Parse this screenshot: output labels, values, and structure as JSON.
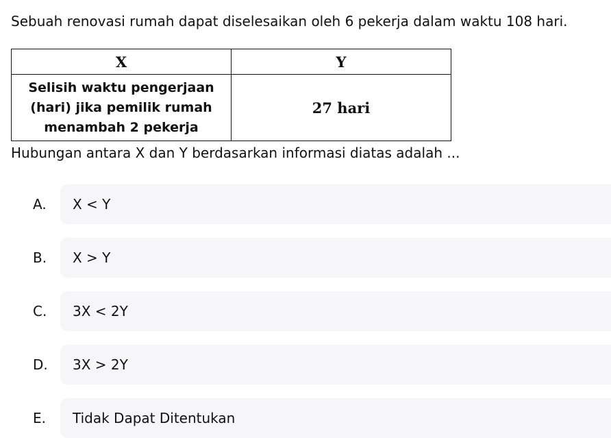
{
  "question": "Sebuah renovasi rumah dapat diselesaikan oleh 6 pekerja dalam waktu 108 hari.",
  "table": {
    "headers": [
      "X",
      "Y"
    ],
    "x_value_lines": [
      "Selisih waktu pengerjaan",
      "(hari) jika pemilik rumah",
      "menambah 2 pekerja"
    ],
    "y_value": "27 hari"
  },
  "prompt": "Hubungan antara X dan Y berdasarkan informasi diatas adalah ...",
  "options": [
    {
      "letter": "A.",
      "text": "X < Y"
    },
    {
      "letter": "B.",
      "text": "X > Y"
    },
    {
      "letter": "C.",
      "text": "3X < 2Y"
    },
    {
      "letter": "D.",
      "text": "3X > 2Y"
    },
    {
      "letter": "E.",
      "text": "Tidak Dapat Ditentukan"
    }
  ]
}
